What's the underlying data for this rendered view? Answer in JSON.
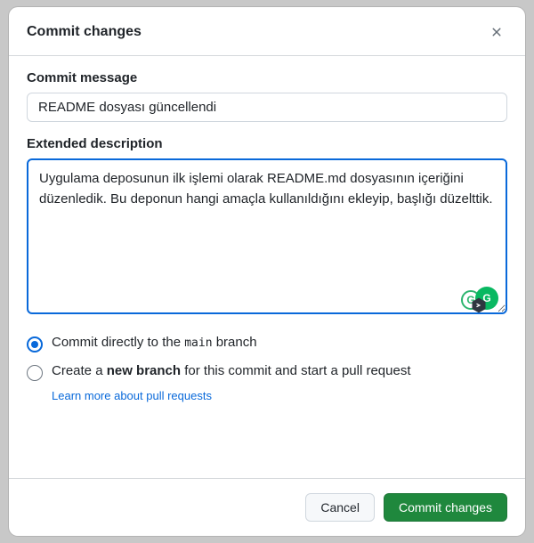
{
  "modal": {
    "title": "Commit changes",
    "commit_message_label": "Commit message",
    "commit_message_value": "README dosyası güncellendi",
    "extended_desc_label": "Extended description",
    "extended_desc_value": "Uygulama deposunun ilk işlemi olarak README.md dosyasının içeriğini düzenledik. Bu deponun hangi amaçla kullanıldığını ekleyip, başlığı düzelttik.",
    "radio_direct_prefix": "Commit directly to the ",
    "radio_direct_branch": "main",
    "radio_direct_suffix": " branch",
    "radio_newbranch_prefix": "Create a ",
    "radio_newbranch_bold": "new branch",
    "radio_newbranch_suffix": " for this commit and start a pull request",
    "learn_more_text": "Learn more about pull requests",
    "cancel_label": "Cancel",
    "commit_label": "Commit changes"
  }
}
